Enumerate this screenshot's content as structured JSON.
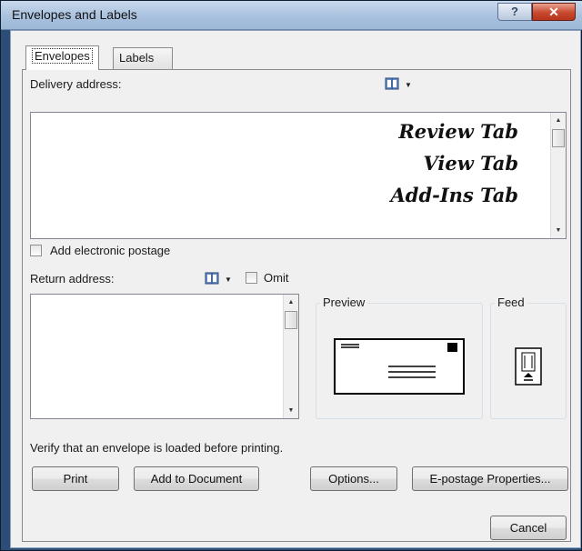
{
  "window": {
    "title": "Envelopes and Labels",
    "help_label": "?",
    "close_label": "✕"
  },
  "tabs": [
    {
      "label": "Envelopes",
      "active": true
    },
    {
      "label": "Labels",
      "active": false
    }
  ],
  "delivery": {
    "label": "Delivery address:",
    "lines": [
      "Review Tab",
      "View Tab",
      "Add-Ins Tab"
    ],
    "address_book_icon": "address-book-icon"
  },
  "postage": {
    "label": "Add electronic postage",
    "checked": false
  },
  "return": {
    "label": "Return address:",
    "omit_label": "Omit",
    "omit_checked": false,
    "value": ""
  },
  "preview": {
    "label": "Preview"
  },
  "feed": {
    "label": "Feed"
  },
  "status": {
    "text": "Verify that an envelope is loaded before printing."
  },
  "buttons": {
    "print": "Print",
    "add_to_document": "Add to Document",
    "options": "Options...",
    "epostage": "E-postage Properties...",
    "cancel": "Cancel"
  }
}
